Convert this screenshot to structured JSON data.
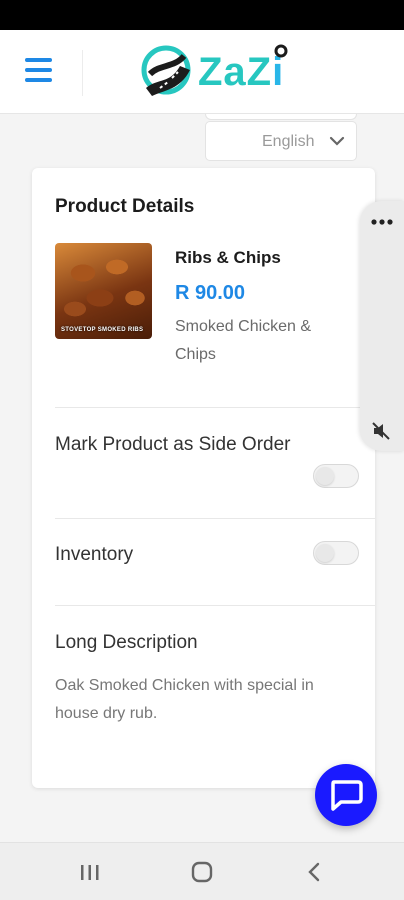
{
  "header": {
    "brand_name_part1": "ZaZ",
    "brand_name_part2": "i"
  },
  "language_select": {
    "selected": "English"
  },
  "product_details": {
    "title": "Product Details",
    "image_caption": "STOVETOP SMOKED RIBS",
    "name": "Ribs & Chips",
    "price": "R 90.00",
    "short_description": "Smoked Chicken & Chips"
  },
  "options": {
    "side_order_label": "Mark Product as Side Order",
    "side_order_enabled": false,
    "inventory_label": "Inventory",
    "inventory_enabled": false
  },
  "long_description": {
    "label": "Long Description",
    "text": "Oak Smoked Chicken with special in house dry rub."
  },
  "icons": {
    "menu": "hamburger-menu-icon",
    "language_chevron": "chevron-down-icon",
    "more": "more-horizontal-icon",
    "mute": "volume-mute-icon",
    "chat": "chat-bubble-icon",
    "nav_recent": "recent-apps-icon",
    "nav_home": "home-icon",
    "nav_back": "back-icon"
  },
  "colors": {
    "accent_blue": "#1e88e5",
    "brand_teal": "#27c7c0",
    "chat_fab": "#1a1aff"
  }
}
